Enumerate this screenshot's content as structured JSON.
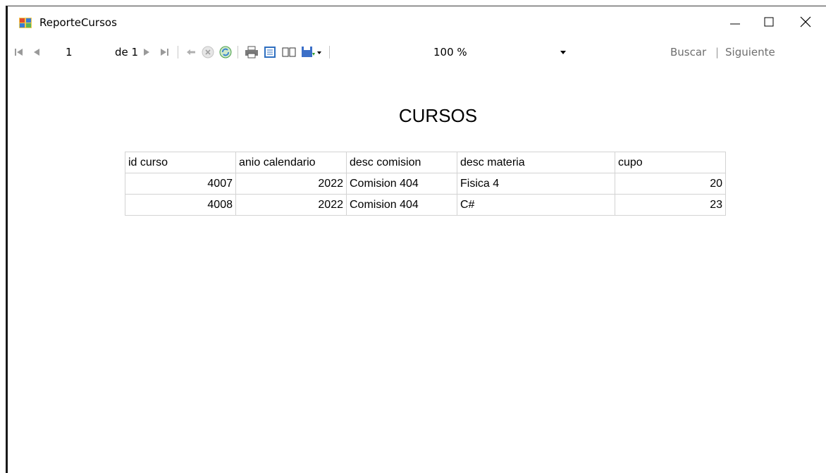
{
  "window": {
    "title": "ReporteCursos",
    "controls": {
      "minimize": "—",
      "maximize": "☐",
      "close": "✕"
    }
  },
  "toolbar": {
    "page_current": "1",
    "page_of": "de 1",
    "zoom_value": "100 %",
    "search_placeholder": "",
    "buscar_label": "Buscar",
    "separator": "|",
    "siguiente_label": "Siguiente",
    "icons": [
      "first-page-icon",
      "prev-page-icon",
      "next-page-icon",
      "last-page-icon",
      "back-icon",
      "stop-icon",
      "refresh-icon",
      "print-icon",
      "print-layout-icon",
      "page-setup-icon",
      "export-icon"
    ]
  },
  "report": {
    "title": "CURSOS",
    "columns": [
      "id curso",
      "anio calendario",
      "desc comision",
      "desc materia",
      "cupo"
    ],
    "rows": [
      [
        "4007",
        "2022",
        "Comision 404",
        "Fisica 4",
        "20"
      ],
      [
        "4008",
        "2022",
        "Comision 404",
        "C#",
        "23"
      ]
    ]
  }
}
